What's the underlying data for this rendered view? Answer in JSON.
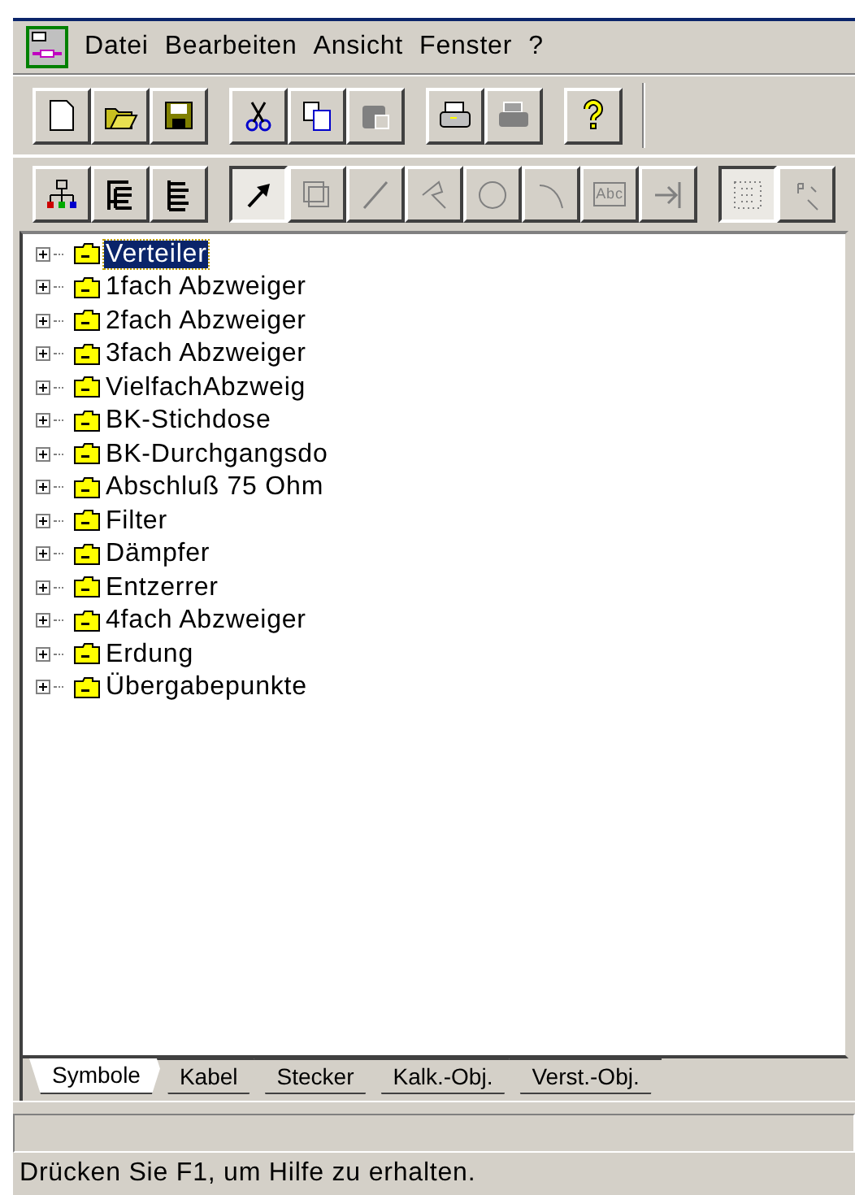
{
  "menu": [
    "Datei",
    "Bearbeiten",
    "Ansicht",
    "Fenster",
    "?"
  ],
  "toolbar": [
    {
      "disabled": false
    },
    {
      "disabled": false
    },
    {
      "disabled": false
    },
    {
      "disabled": false
    },
    {
      "disabled": false
    },
    {
      "disabled": true
    },
    {
      "disabled": false
    },
    {
      "disabled": true
    },
    {
      "disabled": false
    }
  ],
  "draw_toolbar": [
    {
      "pressed": false,
      "disabled": false
    },
    {
      "pressed": false,
      "disabled": false
    },
    {
      "pressed": false,
      "disabled": false
    },
    {
      "pressed": true,
      "disabled": false
    },
    {
      "pressed": false,
      "disabled": true
    },
    {
      "pressed": false,
      "disabled": true
    },
    {
      "pressed": false,
      "disabled": true
    },
    {
      "pressed": false,
      "disabled": true
    },
    {
      "pressed": false,
      "disabled": true
    },
    {
      "pressed": false,
      "disabled": true,
      "label": "Abc"
    },
    {
      "pressed": false,
      "disabled": true
    },
    {
      "pressed": true,
      "disabled": true
    },
    {
      "pressed": false,
      "disabled": true
    }
  ],
  "tree": [
    {
      "label": "Verteiler",
      "selected": true,
      "expanded": false
    },
    {
      "label": "1fach Abzweiger",
      "selected": false,
      "expanded": false
    },
    {
      "label": "2fach Abzweiger",
      "selected": false,
      "expanded": false
    },
    {
      "label": "3fach Abzweiger",
      "selected": false,
      "expanded": false
    },
    {
      "label": "VielfachAbzweig",
      "selected": false,
      "expanded": false
    },
    {
      "label": "BK-Stichdose",
      "selected": false,
      "expanded": false
    },
    {
      "label": "BK-Durchgangsdo",
      "selected": false,
      "expanded": false
    },
    {
      "label": "Abschluß 75 Ohm",
      "selected": false,
      "expanded": false
    },
    {
      "label": "Filter",
      "selected": false,
      "expanded": false
    },
    {
      "label": "Dämpfer",
      "selected": false,
      "expanded": false
    },
    {
      "label": "Entzerrer",
      "selected": false,
      "expanded": false
    },
    {
      "label": "4fach Abzweiger",
      "selected": false,
      "expanded": false
    },
    {
      "label": "Erdung",
      "selected": false,
      "expanded": false
    },
    {
      "label": "Übergabepunkte",
      "selected": false,
      "expanded": false
    }
  ],
  "tabs": [
    {
      "label": "Symbole",
      "selected": true
    },
    {
      "label": "Kabel",
      "selected": false
    },
    {
      "label": "Stecker",
      "selected": false
    },
    {
      "label": "Kalk.-Obj.",
      "selected": false
    },
    {
      "label": "Verst.-Obj.",
      "selected": false
    }
  ],
  "status_bar": "Drücken Sie F1, um Hilfe zu erhalten."
}
